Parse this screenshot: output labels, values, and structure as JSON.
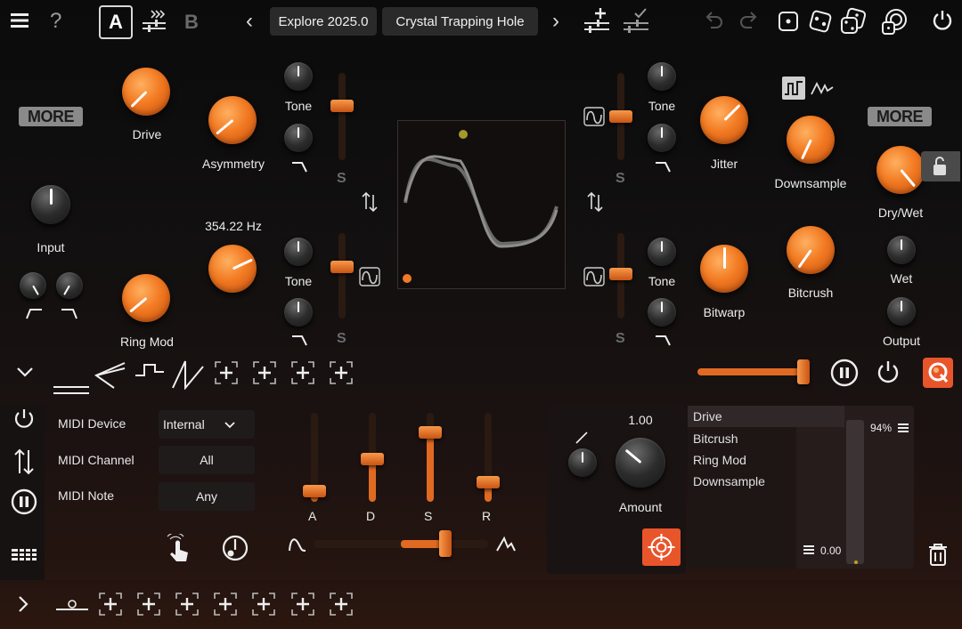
{
  "top": {
    "slot_a": "A",
    "slot_b": "B",
    "preset_bank": "Explore 2025.0",
    "preset_name": "Crystal Trapping Hole",
    "prev": "‹",
    "next": "›",
    "help": "?"
  },
  "more_label": "MORE",
  "knobs": {
    "drive": "Drive",
    "asymmetry": "Asymmetry",
    "input": "Input",
    "ring_mod": "Ring Mod",
    "freq": "354.22 Hz",
    "tone": "Tone",
    "jitter": "Jitter",
    "downsample": "Downsample",
    "dry_wet": "Dry/Wet",
    "bitwarp": "Bitwarp",
    "bitcrush": "Bitcrush",
    "wet": "Wet",
    "output": "Output"
  },
  "s_label": "S",
  "midi": {
    "device_label": "MIDI Device",
    "device_value": "Internal",
    "channel_label": "MIDI Channel",
    "channel_value": "All",
    "note_label": "MIDI Note",
    "note_value": "Any"
  },
  "adsr": {
    "labels": [
      "A",
      "D",
      "S",
      "R"
    ],
    "levels": [
      0.12,
      0.48,
      0.78,
      0.22
    ]
  },
  "amount": {
    "value": "1.00",
    "label": "Amount"
  },
  "mod_targets": [
    "Drive",
    "Bitcrush",
    "Ring Mod",
    "Downsample"
  ],
  "mod_meter": {
    "top": "94%",
    "bottom": "0.00"
  },
  "colors": {
    "accent": "#f07a28",
    "panel": "#1a1414"
  }
}
